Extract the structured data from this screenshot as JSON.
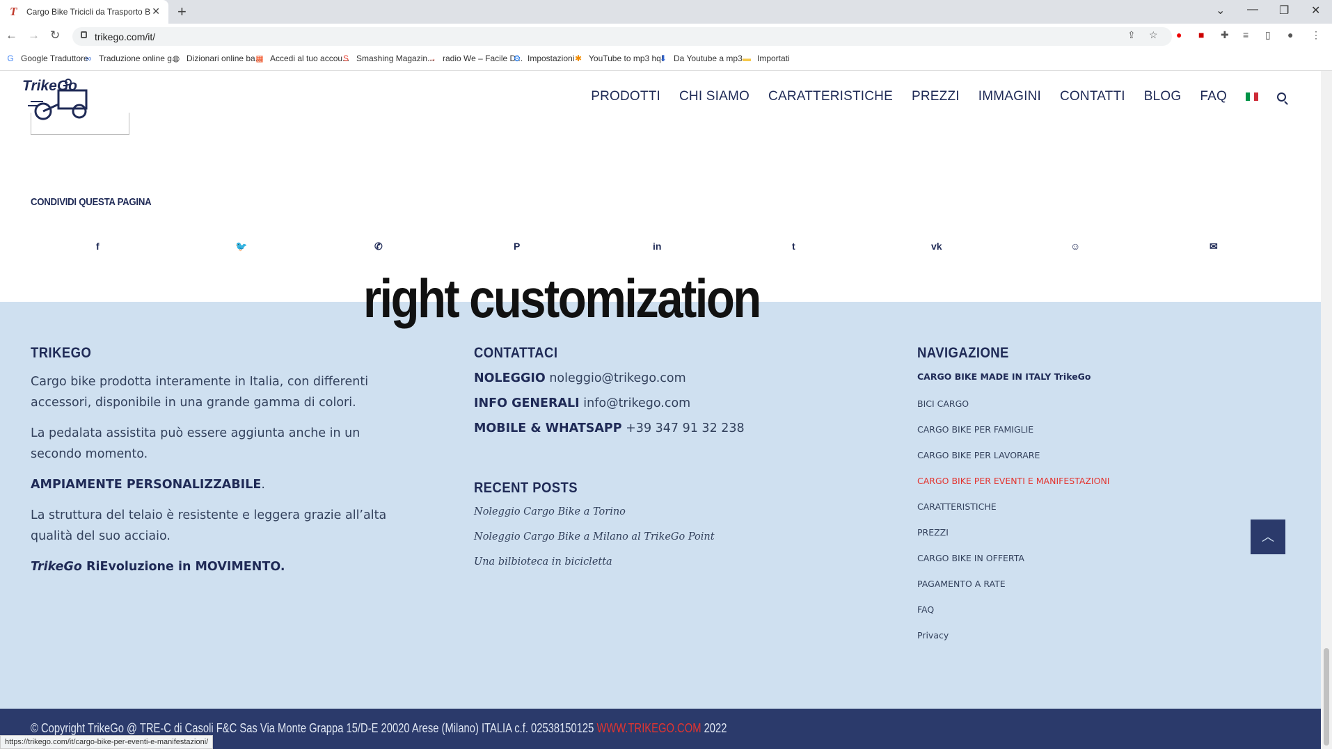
{
  "browser": {
    "tab_title": "Cargo Bike Tricicli da Trasporto B",
    "url": "trikego.com/it/",
    "bookmarks": [
      {
        "label": "Google Traduttore",
        "icon": "google-translate-icon"
      },
      {
        "label": "Traduzione online g...",
        "icon": "translate-icon"
      },
      {
        "label": "Dizionari online ba...",
        "icon": "globe-icon"
      },
      {
        "label": "Accedi al tuo accou...",
        "icon": "microsoft-icon"
      },
      {
        "label": "Smashing Magazin...",
        "icon": "smashing-icon"
      },
      {
        "label": "radio We – Facile D...",
        "icon": "radio-icon"
      },
      {
        "label": "Impostazioni",
        "icon": "gear-icon"
      },
      {
        "label": "YouTube to mp3 hq!",
        "icon": "star-icon"
      },
      {
        "label": "Da Youtube a mp3...",
        "icon": "download-icon"
      },
      {
        "label": "Importati",
        "icon": "folder-icon"
      }
    ],
    "status_url": "https://trikego.com/it/cargo-bike-per-eventi-e-manifestazioni/"
  },
  "header": {
    "logo_text": "TrikeGo",
    "nav": [
      "PRODOTTI",
      "CHI SIAMO",
      "CARATTERISTICHE",
      "PREZZI",
      "IMMAGINI",
      "CONTATTI",
      "BLOG",
      "FAQ"
    ]
  },
  "share": {
    "title": "CONDIVIDI QUESTA PAGINA",
    "icons": [
      {
        "name": "facebook-icon",
        "glyph": "f"
      },
      {
        "name": "twitter-icon",
        "glyph": "🐦"
      },
      {
        "name": "whatsapp-icon",
        "glyph": "✆"
      },
      {
        "name": "pinterest-icon",
        "glyph": "P"
      },
      {
        "name": "linkedin-icon",
        "glyph": "in"
      },
      {
        "name": "tumblr-icon",
        "glyph": "t"
      },
      {
        "name": "vk-icon",
        "glyph": "vk"
      },
      {
        "name": "reddit-icon",
        "glyph": "☺"
      },
      {
        "name": "mail-icon",
        "glyph": "✉"
      }
    ]
  },
  "overlay": "right customization",
  "footer": {
    "trikego": {
      "heading": "TRIKEGO",
      "p1": "Cargo bike prodotta interamente in Italia, con differenti accessori, disponibile in una grande gamma di colori.",
      "p2": "La pedalata assistita può essere aggiunta anche in un secondo momento.",
      "p3_strong": "AMPIAMENTE PERSONALIZZABILE",
      "p3_tail": ".",
      "p4": "La struttura del telaio è resistente e leggera grazie all’alta qualità del suo acciaio.",
      "p5_em": "TrikeGo",
      "p5_strong": " RiEvoluzione in MOVIMENTO."
    },
    "contact": {
      "heading": "CONTATTACI",
      "lines": [
        {
          "label": "NOLEGGIO",
          "value": " noleggio@trikego.com"
        },
        {
          "label": "INFO GENERALI",
          "value": " info@trikego.com"
        },
        {
          "label": "MOBILE & WHATSAPP",
          "value": " +39 347 91 32 238"
        }
      ]
    },
    "recent": {
      "heading": "RECENT POSTS",
      "posts": [
        "Noleggio Cargo Bike a Torino",
        "Noleggio Cargo Bike a Milano al TrikeGo Point",
        "Una bilbioteca in bicicletta"
      ]
    },
    "navigation": {
      "heading": "NAVIGAZIONE",
      "top_link": "CARGO BIKE MADE IN ITALY TrikeGo",
      "links": [
        "BICI CARGO",
        "CARGO BIKE PER FAMIGLIE",
        "CARGO BIKE PER LAVORARE",
        "CARGO BIKE PER EVENTI E MANIFESTAZIONI",
        "CARATTERISTICHE",
        "PREZZI",
        "CARGO BIKE IN OFFERTA",
        "PAGAMENTO A RATE",
        "FAQ",
        "Privacy"
      ],
      "active_index": 3
    },
    "copyright_main": "© Copyright TrikeGo @ TRE-C di Casoli F&C Sas Via Monte Grappa 15/D-E 20020 Arese (Milano) ITALIA c.f. 02538150125 ",
    "copyright_link": "WWW.TRIKEGO.COM",
    "copyright_year": " 2022"
  },
  "colors": {
    "brand_navy": "#1f2a56",
    "footer_bg": "#cfe0f0",
    "accent_red": "#e3342f"
  }
}
